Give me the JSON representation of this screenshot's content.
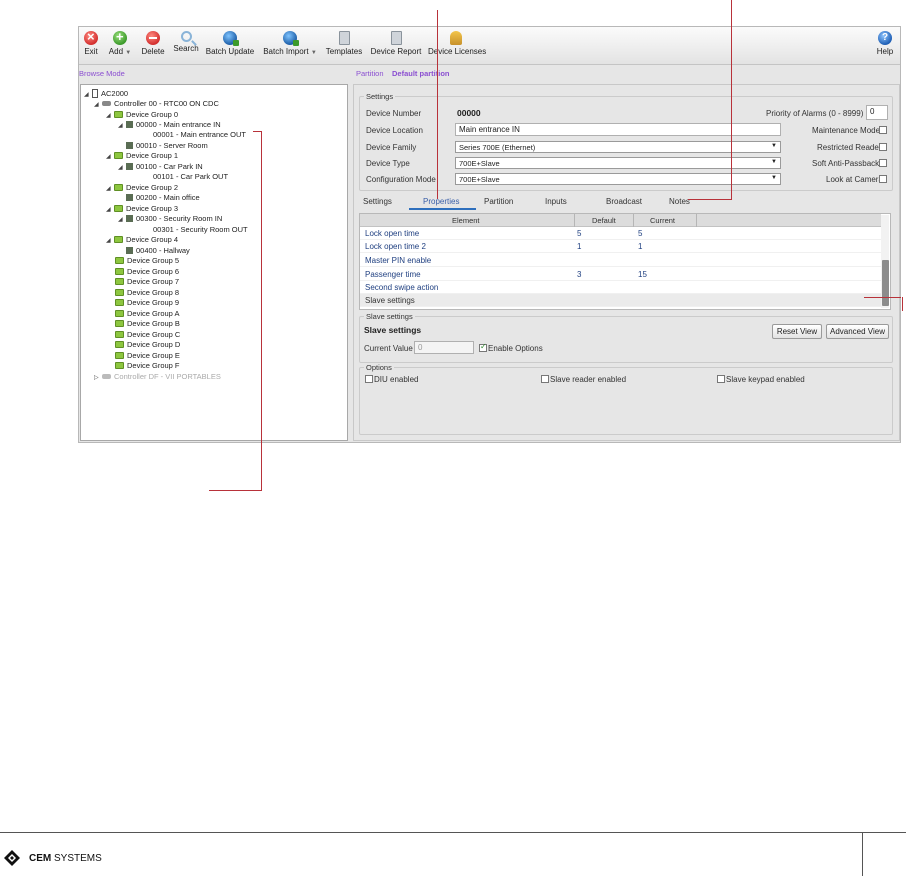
{
  "toolbar": {
    "exit": "Exit",
    "add": "Add",
    "delete": "Delete",
    "search": "Search",
    "batch_update": "Batch Update",
    "batch_import": "Batch Import",
    "templates": "Templates",
    "device_report": "Device Report",
    "device_licenses": "Device Licenses",
    "help": "Help"
  },
  "mode_bar": {
    "browse_mode": "Browse Mode",
    "partition_label": "Partition",
    "partition_value": "Default partition"
  },
  "tree": [
    "AC2000",
    "Controller 00 - RTC00 ON CDC",
    "Device Group 0",
    "00000 - Main entrance IN",
    "00001 - Main entrance OUT",
    "00010 - Server Room",
    "Device Group 1",
    "00100 - Car Park IN",
    "00101 - Car Park OUT",
    "Device Group 2",
    "00200 - Main office",
    "Device Group 3",
    "00300 - Security Room IN",
    "00301 - Security Room OUT",
    "Device Group 4",
    "00400 - Hallway",
    "Device Group 5",
    "Device Group 6",
    "Device Group 7",
    "Device Group 8",
    "Device Group 9",
    "Device Group A",
    "Device Group B",
    "Device Group C",
    "Device Group D",
    "Device Group E",
    "Device Group F",
    "Controller DF - VII PORTABLES"
  ],
  "settings": {
    "title": "Settings",
    "device_number_label": "Device Number",
    "device_number": "00000",
    "priority_label": "Priority of Alarms (0 - 8999)",
    "priority_value": "0",
    "device_location_label": "Device Location",
    "device_location": "Main entrance IN",
    "maintenance_mode": "Maintenance Mode",
    "device_family_label": "Device Family",
    "device_family": "Series 700E (Ethernet)",
    "restricted_reader": "Restricted Reader",
    "device_type_label": "Device Type",
    "device_type": "700E+Slave",
    "soft_anti_passback": "Soft Anti-Passback",
    "configuration_mode_label": "Configuration Mode",
    "configuration_mode": "700E+Slave",
    "look_at_camera": "Look at Camera"
  },
  "tabs": [
    "Settings",
    "Properties",
    "Partition",
    "Inputs",
    "Broadcast",
    "Notes"
  ],
  "grid": {
    "columns": [
      "Element",
      "Default",
      "Current"
    ],
    "rows": [
      {
        "element": "Lock open time",
        "default": "5",
        "current": "5"
      },
      {
        "element": "Lock open time 2",
        "default": "1",
        "current": "1"
      },
      {
        "element": "Master PIN enable",
        "default": "",
        "current": ""
      },
      {
        "element": "Passenger time",
        "default": "3",
        "current": "15"
      },
      {
        "element": "Second swipe action",
        "default": "",
        "current": ""
      },
      {
        "element": "Slave settings",
        "default": "",
        "current": ""
      }
    ]
  },
  "slave": {
    "group_title": "Slave settings",
    "heading": "Slave settings",
    "reset_view": "Reset View",
    "advanced_view": "Advanced View",
    "current_value_label": "Current Value",
    "current_value": "0",
    "enable_options": "Enable Options"
  },
  "options": {
    "title": "Options",
    "diu_enabled": "DIU enabled",
    "slave_reader_enabled": "Slave reader enabled",
    "slave_keypad_enabled": "Slave keypad enabled"
  },
  "footer": {
    "brand_bold": "CEM",
    "brand_rest": " SYSTEMS"
  }
}
